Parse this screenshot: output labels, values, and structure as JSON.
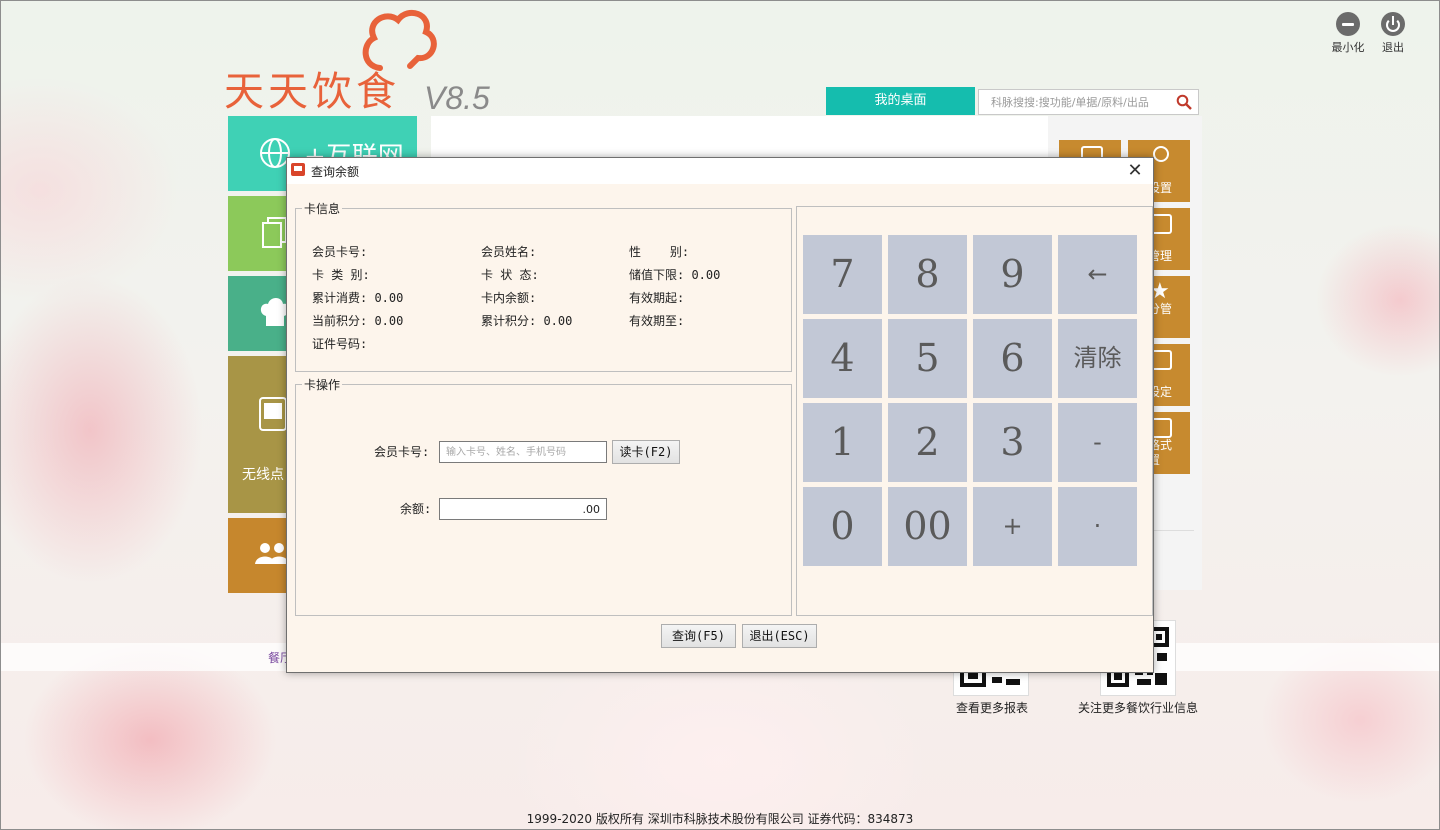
{
  "window": {
    "minimize_label": "最小化",
    "exit_label": "退出"
  },
  "logo": {
    "name": "天天饮食",
    "version": "V8.5"
  },
  "header": {
    "desk_tab": "我的桌面",
    "search_placeholder": "科脉搜搜:搜功能/单据/原料/出品"
  },
  "tiles": {
    "internet": "+互联网",
    "wireless": "无线点"
  },
  "right_tiles": [
    "",
    "员设置",
    "期管理",
    "积分管\n理",
    "额设定",
    "卡格式\n设置"
  ],
  "band": {
    "text": "餐厅"
  },
  "qr": {
    "reports_label": "查看更多报表",
    "follow_label": "关注更多餐饮行业信息"
  },
  "footer": "1999-2020  版权所有  深圳市科脉技术股份有限公司  证券代码：834873",
  "dialog": {
    "title": "查询余额",
    "card_info": {
      "legend": "卡信息",
      "card_no": "会员卡号:",
      "member_name": "会员姓名:",
      "gender": "性    别:",
      "card_type": "卡 类 别:",
      "card_status": "卡 状 态:",
      "stored_min": "储值下限: 0.00",
      "total_spent": "累计消费: 0.00",
      "balance_in_card": "卡内余额:",
      "valid_from": "有效期起:",
      "current_points": "当前积分: 0.00",
      "total_points": "累计积分: 0.00",
      "valid_to": "有效期至:",
      "id_no": "证件号码:"
    },
    "card_ops": {
      "legend": "卡操作",
      "card_no_label": "会员卡号:",
      "card_no_placeholder": "输入卡号、姓名、手机号码",
      "read_card_button": "读卡(F2)",
      "balance_label": "余额:",
      "balance_value": ".00"
    },
    "keypad": [
      "7",
      "8",
      "9",
      "←",
      "4",
      "5",
      "6",
      "清除",
      "1",
      "2",
      "3",
      "-",
      "0",
      "00",
      "+",
      "·"
    ],
    "query_button": "查询(F5)",
    "exit_button": "退出(ESC)"
  }
}
